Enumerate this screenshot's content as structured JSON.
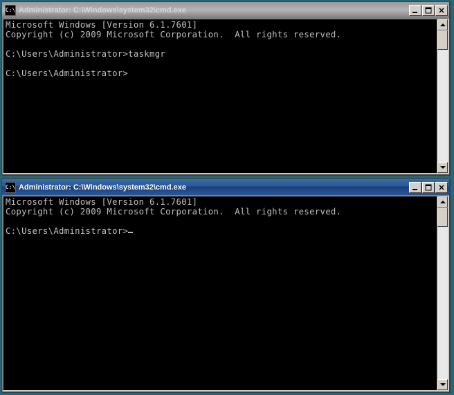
{
  "window1": {
    "title": "Administrator: C:\\Windows\\system32\\cmd.exe",
    "icon_text": "C:\\",
    "lines": {
      "l1": "Microsoft Windows [Version 6.1.7601]",
      "l2": "Copyright (c) 2009 Microsoft Corporation.  All rights reserved.",
      "l3": "",
      "l4": "C:\\Users\\Administrator>taskmgr",
      "l5": "",
      "l6": "C:\\Users\\Administrator>"
    }
  },
  "window2": {
    "title": "Administrator: C:\\Windows\\system32\\cmd.exe",
    "icon_text": "C:\\",
    "lines": {
      "l1": "Microsoft Windows [Version 6.1.7601]",
      "l2": "Copyright (c) 2009 Microsoft Corporation.  All rights reserved.",
      "l3": "",
      "l4": "C:\\Users\\Administrator>"
    }
  }
}
